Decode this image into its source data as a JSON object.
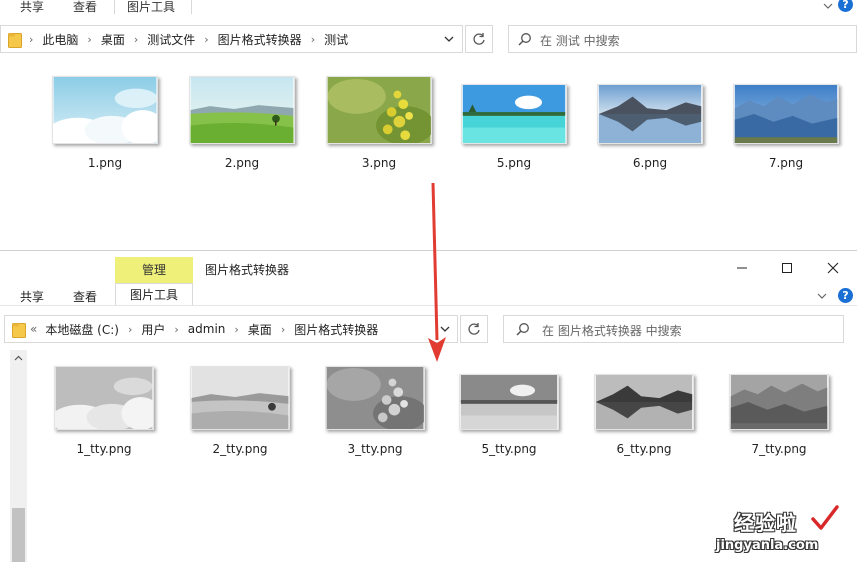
{
  "top_window": {
    "ribbon_tabs": [
      "共享",
      "查看",
      "图片工具"
    ],
    "help": "?",
    "breadcrumb": [
      "此电脑",
      "桌面",
      "测试文件",
      "图片格式转换器",
      "测试"
    ],
    "search_placeholder": "在 测试 中搜索",
    "files": [
      "1.png",
      "2.png",
      "3.png",
      "5.png",
      "6.png",
      "7.png"
    ]
  },
  "bottom_window": {
    "manage_tab": "管理",
    "title": "图片格式转换器",
    "ribbon_tabs": [
      "共享",
      "查看"
    ],
    "tool_tab": "图片工具",
    "help": "?",
    "breadcrumb_prefix": "«",
    "breadcrumb": [
      "本地磁盘 (C:)",
      "用户",
      "admin",
      "桌面",
      "图片格式转换器"
    ],
    "search_placeholder": "在 图片格式转换器 中搜索",
    "files": [
      "1_tty.png",
      "2_tty.png",
      "3_tty.png",
      "5_tty.png",
      "6_tty.png",
      "7_tty.png"
    ]
  },
  "watermark": {
    "title": "经验啦",
    "url": "jingyanla.com"
  },
  "icons": {
    "folder": "folder-icon",
    "chevron": "chevron-down-icon",
    "refresh": "refresh-icon",
    "search": "search-icon",
    "minimize": "minimize-icon",
    "maximize": "maximize-icon",
    "close": "close-icon",
    "scroll_up": "scroll-up-icon",
    "arrow": "red-down-arrow-icon",
    "check": "check-icon"
  },
  "colors": {
    "manage_tab_bg": "#eef079",
    "help_blue": "#1a6fd4",
    "arrow_red": "#e23b32",
    "folder_yellow": "#f5c84a"
  }
}
